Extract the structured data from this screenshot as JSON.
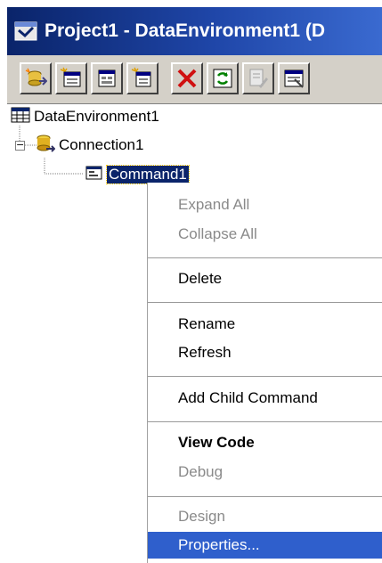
{
  "window": {
    "title": "Project1 - DataEnvironment1 (D"
  },
  "toolbar": {
    "buttons": [
      {
        "name": "add-connection-icon"
      },
      {
        "name": "add-command-icon"
      },
      {
        "name": "insert-stored-procedures-icon"
      },
      {
        "name": "add-child-command-icon"
      },
      {
        "name": "delete-icon"
      },
      {
        "name": "refresh-icon"
      },
      {
        "name": "design-icon"
      },
      {
        "name": "properties-icon"
      }
    ]
  },
  "tree": {
    "root": {
      "label": "DataEnvironment1",
      "icon": "data-environment-icon"
    },
    "connection": {
      "label": "Connection1",
      "icon": "connection-icon"
    },
    "command": {
      "label": "Command1",
      "icon": "command-icon",
      "selected": true
    }
  },
  "context_menu": {
    "items": [
      {
        "label": "Expand All",
        "disabled": true
      },
      {
        "label": "Collapse All",
        "disabled": true
      },
      {
        "label": "Delete"
      },
      {
        "label": "Rename"
      },
      {
        "label": "Refresh"
      },
      {
        "label": "Add Child Command"
      },
      {
        "label": "View Code",
        "bold": true
      },
      {
        "label": "Debug",
        "disabled": true
      },
      {
        "label": "Design",
        "disabled": true
      },
      {
        "label": "Properties...",
        "highlighted": true
      }
    ]
  },
  "colors": {
    "title_bar": "#0a246a",
    "selection": "#0a246a",
    "menu_highlight": "#2f5fcc",
    "disabled_text": "#8a8a8a",
    "toolbar_face": "#d4d0c8"
  }
}
